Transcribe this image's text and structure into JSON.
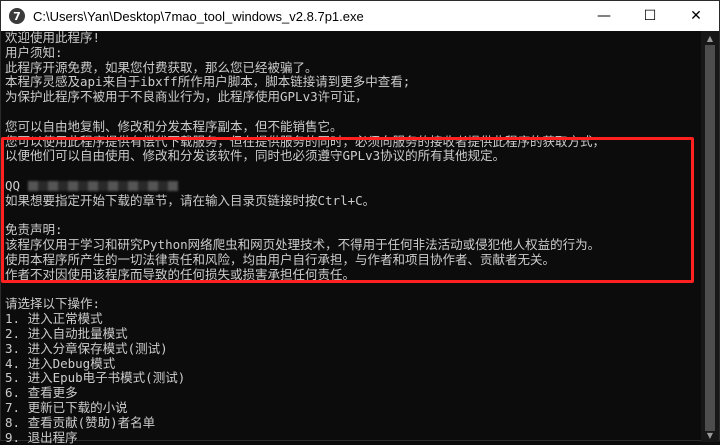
{
  "window": {
    "title": "C:\\Users\\Yan\\Desktop\\7mao_tool_windows_v2.8.7p1.exe",
    "icon_glyph": "7",
    "minimize_glyph": "—",
    "maximize_glyph": "☐",
    "close_glyph": "✕"
  },
  "console": {
    "lines": [
      "欢迎使用此程序!",
      "用户须知:",
      "此程序开源免费，如果您付费获取，那么您已经被骗了。",
      "本程序灵感及api来自于ibxff所作用户脚本，脚本链接请到更多中查看;",
      "为保护此程序不被用于不良商业行为，此程序使用GPLv3许可证，",
      "",
      "您可以自由地复制、修改和分发本程序副本，但不能销售它。",
      "您可以使用此程序提供有偿代下载服务，但在提供服务的同时，必须向服务的接收者提供此程序的获取方式，",
      "以便他们可以自由使用、修改和分发该软件，同时也必须遵守GPLv3协议的所有其他规定。",
      "",
      "QQ",
      "如果想要指定开始下载的章节，请在输入目录页链接时按Ctrl+C。",
      "",
      "免责声明:",
      "该程序仅用于学习和研究Python网络爬虫和网页处理技术，不得用于任何非法活动或侵犯他人权益的行为。",
      "使用本程序所产生的一切法律责任和风险，均由用户自行承担，与作者和项目协作者、贡献者无关。",
      "作者不对因使用该程序而导致的任何损失或损害承担任何责任。",
      "",
      "请选择以下操作:",
      "1. 进入正常模式",
      "2. 进入自动批量模式",
      "3. 进入分章保存模式(测试)",
      "4. 进入Debug模式",
      "5. 进入Epub电子书模式(测试)",
      "6. 查看更多",
      "7. 更新已下载的小说",
      "8. 查看贡献(赞助)者名单",
      "9. 退出程序"
    ]
  },
  "colors": {
    "terminal_bg": "#0c0c0c",
    "terminal_text": "#cccccc",
    "highlight": "#ff2020"
  }
}
